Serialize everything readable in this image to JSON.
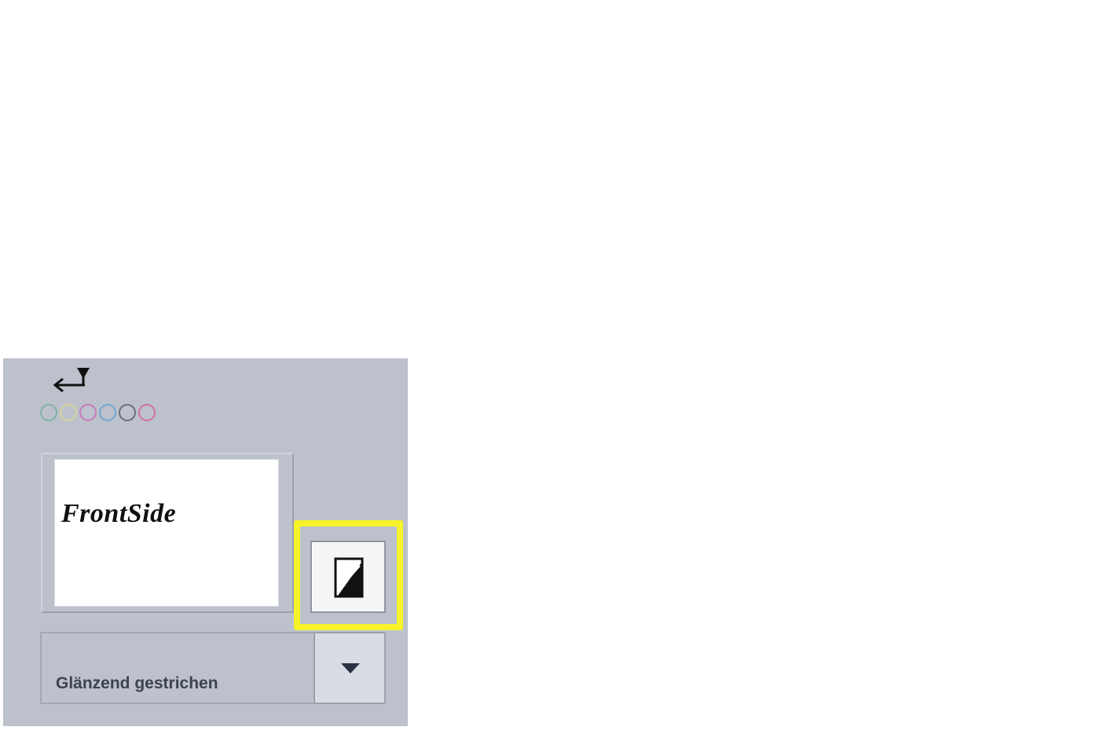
{
  "icons": {
    "feed": "paper-feed-arrow-icon",
    "ink_dots": "ink-color-dots",
    "side_toggle": "duplex-side-icon",
    "dropdown_arrow": "chevron-down-icon"
  },
  "preview": {
    "text": "FrontSide"
  },
  "media": {
    "selected": "Glänzend gestrichen"
  },
  "colors": {
    "panel": "#bcc1cc",
    "highlight": "#f7f32a",
    "ink_dots": [
      "#7fb3a6",
      "#d9d49a",
      "#c97bb8",
      "#6fa8d4",
      "#6c6f7a",
      "#d36fa0"
    ]
  }
}
